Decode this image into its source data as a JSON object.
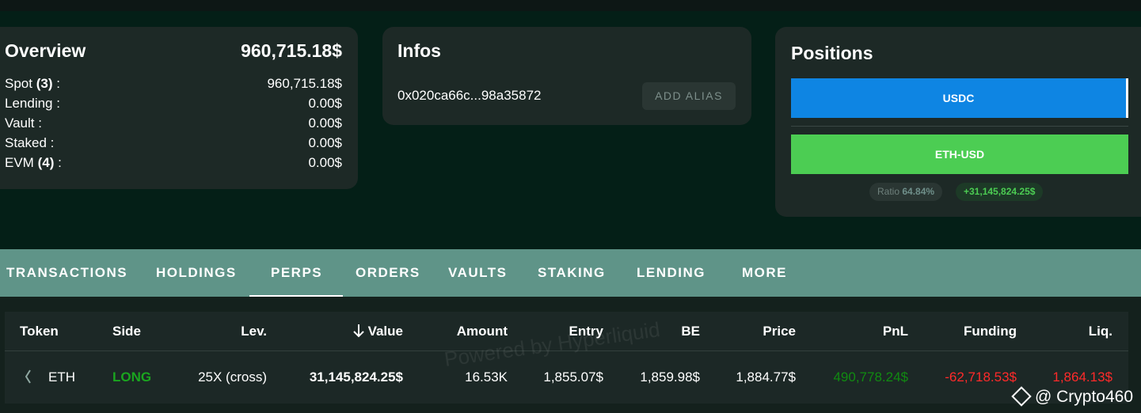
{
  "overview": {
    "title": "Overview",
    "total": "960,715.18$",
    "rows": [
      {
        "label": "Spot",
        "count": "(3)",
        "suffix": " :",
        "value": "960,715.18$"
      },
      {
        "label": "Lending :",
        "count": "",
        "suffix": "",
        "value": "0.00$"
      },
      {
        "label": "Vault :",
        "count": "",
        "suffix": "",
        "value": "0.00$"
      },
      {
        "label": "Staked :",
        "count": "",
        "suffix": "",
        "value": "0.00$"
      },
      {
        "label": "EVM",
        "count": "(4)",
        "suffix": " :",
        "value": "0.00$"
      }
    ]
  },
  "infos": {
    "title": "Infos",
    "address": "0x020ca66c...98a35872",
    "add_alias_label": "ADD ALIAS"
  },
  "positions": {
    "title": "Positions",
    "bars": [
      {
        "label": "USDC",
        "color": "#0e85e3"
      },
      {
        "label": "ETH-USD",
        "color": "#4ccd53"
      }
    ],
    "ratio_label": "Ratio",
    "ratio_value": "64.84%",
    "pnl": "+31,145,824.25$"
  },
  "tabs": [
    {
      "label": "TRANSACTIONS"
    },
    {
      "label": "HOLDINGS"
    },
    {
      "label": "PERPS",
      "active": true
    },
    {
      "label": "ORDERS"
    },
    {
      "label": "VAULTS"
    },
    {
      "label": "STAKING"
    },
    {
      "label": "LENDING"
    },
    {
      "label": "MORE"
    }
  ],
  "table": {
    "headers": {
      "token": "Token",
      "side": "Side",
      "lev": "Lev.",
      "value": "Value",
      "amount": "Amount",
      "entry": "Entry",
      "be": "BE",
      "price": "Price",
      "pnl": "PnL",
      "funding": "Funding",
      "liq": "Liq."
    },
    "sort_icon": "arrow-down-icon",
    "rows": [
      {
        "token": "ETH",
        "side": "LONG",
        "lev": "25X (cross)",
        "value": "31,145,824.25$",
        "amount": "16.53K",
        "entry": "1,855.07$",
        "be": "1,859.98$",
        "price": "1,884.77$",
        "pnl": "490,778.24$",
        "funding": "-62,718.53$",
        "liq": "1,864.13$"
      }
    ]
  },
  "watermark": "Powered by Hyperliquid",
  "brand": "@ Crypto460",
  "colors": {
    "long": "#1aa51f",
    "pnl_positive": "#118a11",
    "negative": "#ff2a2a",
    "tabs_bg": "#5f9488"
  }
}
